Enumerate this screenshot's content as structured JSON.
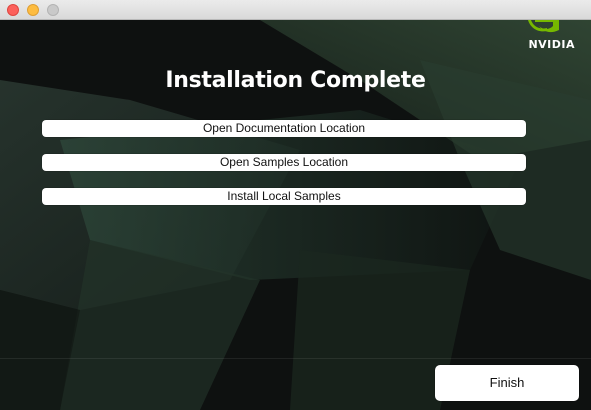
{
  "window": {
    "controls": [
      "close",
      "minimize",
      "zoom"
    ]
  },
  "brand": {
    "name": "NVIDIA",
    "accent": "#76b900"
  },
  "page": {
    "title": "Installation Complete"
  },
  "actions": {
    "open_docs_label": "Open Documentation Location",
    "open_samples_label": "Open Samples Location",
    "install_samples_label": "Install Local Samples"
  },
  "footer": {
    "finish_label": "Finish"
  },
  "icons": {
    "close": "close-icon",
    "minimize": "minimize-icon",
    "zoom": "zoom-icon",
    "logo": "nvidia-logo-icon"
  }
}
